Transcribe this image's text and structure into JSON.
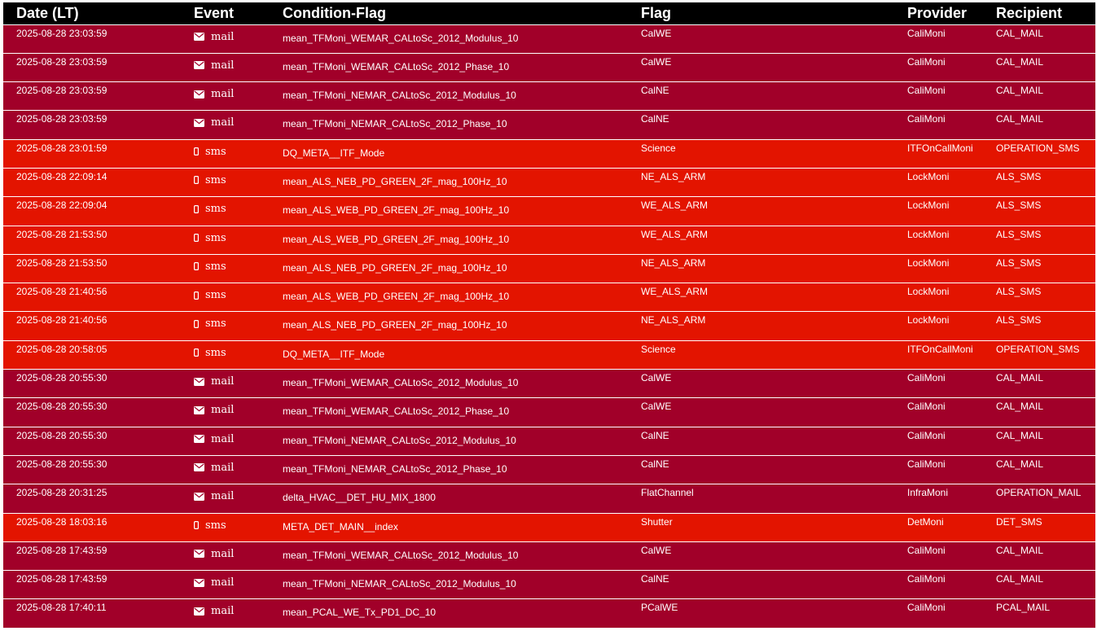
{
  "colors": {
    "header_bg": "#000000",
    "mail_row": "#a10029",
    "sms_row": "#e31400",
    "text": "#ffffff"
  },
  "table": {
    "headers": [
      "Date (LT)",
      "Event",
      "Condition-Flag",
      "Flag",
      "Provider",
      "Recipient"
    ],
    "rows": [
      {
        "date": "2025-08-28 23:03:59",
        "event": "mail",
        "icon": "envelope-icon",
        "condition": "mean_TFMoni_WEMAR_CALtoSc_2012_Modulus_10",
        "flag": "CalWE",
        "provider": "CaliMoni",
        "recipient": "CAL_MAIL"
      },
      {
        "date": "2025-08-28 23:03:59",
        "event": "mail",
        "icon": "envelope-icon",
        "condition": "mean_TFMoni_WEMAR_CALtoSc_2012_Phase_10",
        "flag": "CalWE",
        "provider": "CaliMoni",
        "recipient": "CAL_MAIL"
      },
      {
        "date": "2025-08-28 23:03:59",
        "event": "mail",
        "icon": "envelope-icon",
        "condition": "mean_TFMoni_NEMAR_CALtoSc_2012_Modulus_10",
        "flag": "CalNE",
        "provider": "CaliMoni",
        "recipient": "CAL_MAIL"
      },
      {
        "date": "2025-08-28 23:03:59",
        "event": "mail",
        "icon": "envelope-icon",
        "condition": "mean_TFMoni_NEMAR_CALtoSc_2012_Phase_10",
        "flag": "CalNE",
        "provider": "CaliMoni",
        "recipient": "CAL_MAIL"
      },
      {
        "date": "2025-08-28 23:01:59",
        "event": "sms",
        "icon": "mobile-phone-icon",
        "condition": "DQ_META__ITF_Mode",
        "flag": "Science",
        "provider": "ITFOnCallMoni",
        "recipient": "OPERATION_SMS"
      },
      {
        "date": "2025-08-28 22:09:14",
        "event": "sms",
        "icon": "mobile-phone-icon",
        "condition": "mean_ALS_NEB_PD_GREEN_2F_mag_100Hz_10",
        "flag": "NE_ALS_ARM",
        "provider": "LockMoni",
        "recipient": "ALS_SMS"
      },
      {
        "date": "2025-08-28 22:09:04",
        "event": "sms",
        "icon": "mobile-phone-icon",
        "condition": "mean_ALS_WEB_PD_GREEN_2F_mag_100Hz_10",
        "flag": "WE_ALS_ARM",
        "provider": "LockMoni",
        "recipient": "ALS_SMS"
      },
      {
        "date": "2025-08-28 21:53:50",
        "event": "sms",
        "icon": "mobile-phone-icon",
        "condition": "mean_ALS_WEB_PD_GREEN_2F_mag_100Hz_10",
        "flag": "WE_ALS_ARM",
        "provider": "LockMoni",
        "recipient": "ALS_SMS"
      },
      {
        "date": "2025-08-28 21:53:50",
        "event": "sms",
        "icon": "mobile-phone-icon",
        "condition": "mean_ALS_NEB_PD_GREEN_2F_mag_100Hz_10",
        "flag": "NE_ALS_ARM",
        "provider": "LockMoni",
        "recipient": "ALS_SMS"
      },
      {
        "date": "2025-08-28 21:40:56",
        "event": "sms",
        "icon": "mobile-phone-icon",
        "condition": "mean_ALS_WEB_PD_GREEN_2F_mag_100Hz_10",
        "flag": "WE_ALS_ARM",
        "provider": "LockMoni",
        "recipient": "ALS_SMS"
      },
      {
        "date": "2025-08-28 21:40:56",
        "event": "sms",
        "icon": "mobile-phone-icon",
        "condition": "mean_ALS_NEB_PD_GREEN_2F_mag_100Hz_10",
        "flag": "NE_ALS_ARM",
        "provider": "LockMoni",
        "recipient": "ALS_SMS"
      },
      {
        "date": "2025-08-28 20:58:05",
        "event": "sms",
        "icon": "mobile-phone-icon",
        "condition": "DQ_META__ITF_Mode",
        "flag": "Science",
        "provider": "ITFOnCallMoni",
        "recipient": "OPERATION_SMS"
      },
      {
        "date": "2025-08-28 20:55:30",
        "event": "mail",
        "icon": "envelope-icon",
        "condition": "mean_TFMoni_WEMAR_CALtoSc_2012_Modulus_10",
        "flag": "CalWE",
        "provider": "CaliMoni",
        "recipient": "CAL_MAIL"
      },
      {
        "date": "2025-08-28 20:55:30",
        "event": "mail",
        "icon": "envelope-icon",
        "condition": "mean_TFMoni_WEMAR_CALtoSc_2012_Phase_10",
        "flag": "CalWE",
        "provider": "CaliMoni",
        "recipient": "CAL_MAIL"
      },
      {
        "date": "2025-08-28 20:55:30",
        "event": "mail",
        "icon": "envelope-icon",
        "condition": "mean_TFMoni_NEMAR_CALtoSc_2012_Modulus_10",
        "flag": "CalNE",
        "provider": "CaliMoni",
        "recipient": "CAL_MAIL"
      },
      {
        "date": "2025-08-28 20:55:30",
        "event": "mail",
        "icon": "envelope-icon",
        "condition": "mean_TFMoni_NEMAR_CALtoSc_2012_Phase_10",
        "flag": "CalNE",
        "provider": "CaliMoni",
        "recipient": "CAL_MAIL"
      },
      {
        "date": "2025-08-28 20:31:25",
        "event": "mail",
        "icon": "envelope-icon",
        "condition": "delta_HVAC__DET_HU_MIX_1800",
        "flag": "FlatChannel",
        "provider": "InfraMoni",
        "recipient": "OPERATION_MAIL"
      },
      {
        "date": "2025-08-28 18:03:16",
        "event": "sms",
        "icon": "mobile-phone-icon",
        "condition": "META_DET_MAIN__index",
        "flag": "Shutter",
        "provider": "DetMoni",
        "recipient": "DET_SMS"
      },
      {
        "date": "2025-08-28 17:43:59",
        "event": "mail",
        "icon": "envelope-icon",
        "condition": "mean_TFMoni_WEMAR_CALtoSc_2012_Modulus_10",
        "flag": "CalWE",
        "provider": "CaliMoni",
        "recipient": "CAL_MAIL"
      },
      {
        "date": "2025-08-28 17:43:59",
        "event": "mail",
        "icon": "envelope-icon",
        "condition": "mean_TFMoni_NEMAR_CALtoSc_2012_Modulus_10",
        "flag": "CalNE",
        "provider": "CaliMoni",
        "recipient": "CAL_MAIL"
      },
      {
        "date": "2025-08-28 17:40:11",
        "event": "mail",
        "icon": "envelope-icon",
        "condition": "mean_PCAL_WE_Tx_PD1_DC_10",
        "flag": "PCalWE",
        "provider": "CaliMoni",
        "recipient": "PCAL_MAIL"
      }
    ]
  }
}
